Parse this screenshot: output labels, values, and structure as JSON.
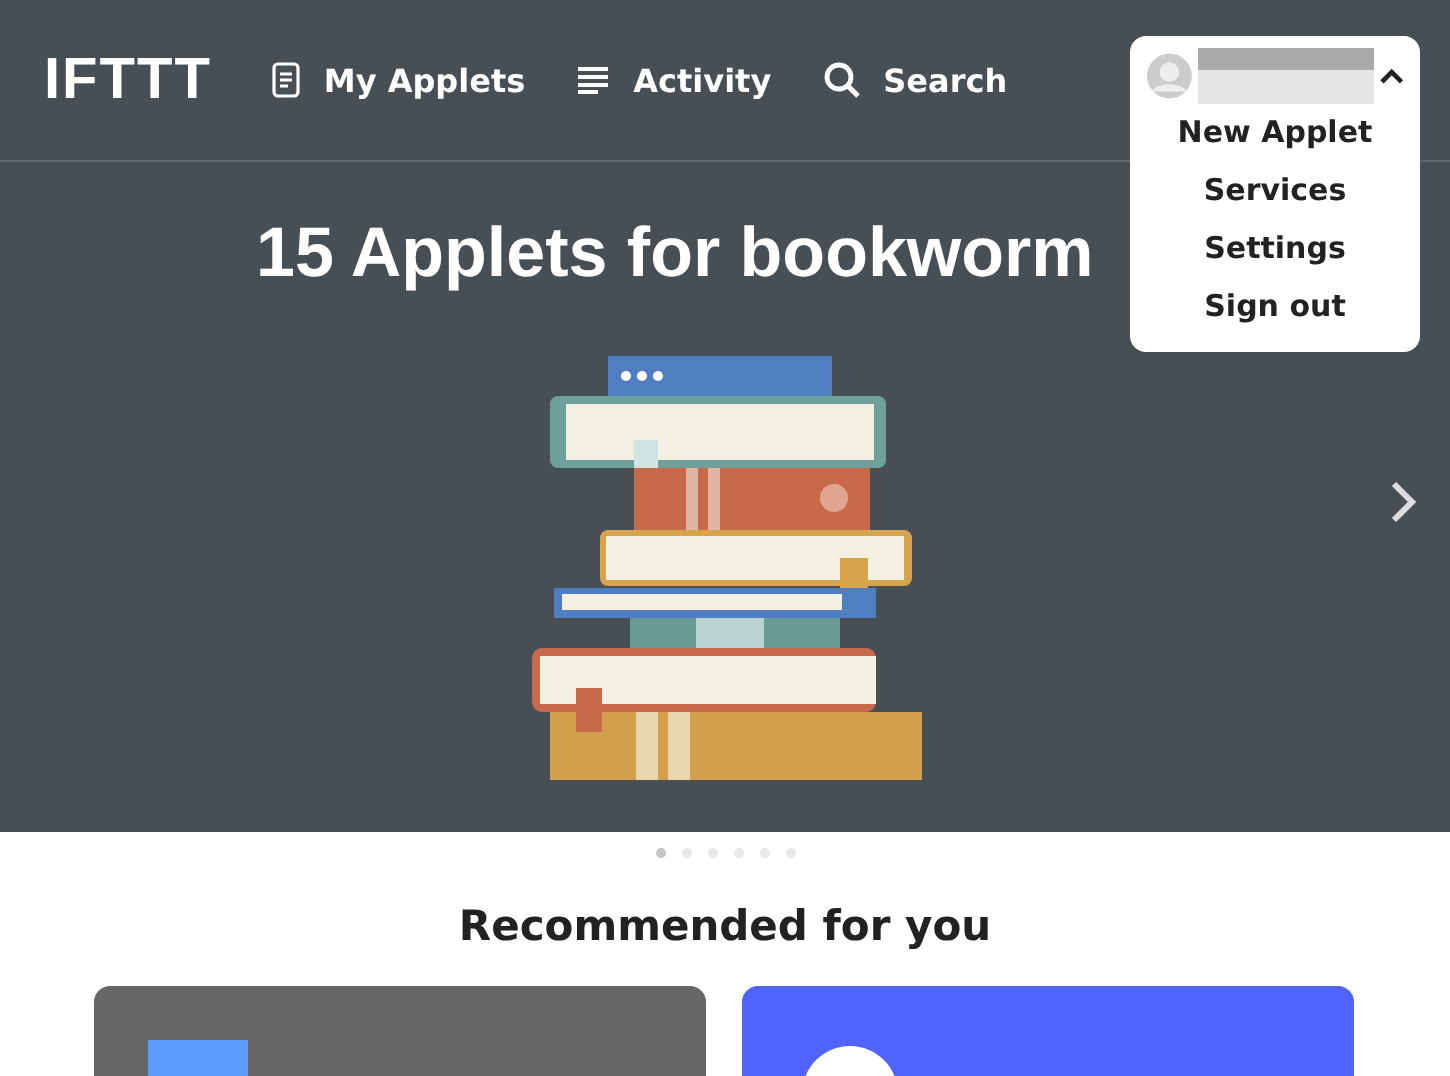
{
  "header": {
    "logo": "IFTTT",
    "nav": [
      {
        "label": "My Applets",
        "kind": "document"
      },
      {
        "label": "Activity",
        "kind": "lines"
      },
      {
        "label": "Search",
        "kind": "search"
      }
    ]
  },
  "account_menu": {
    "expanded": true,
    "items": [
      "New Applet",
      "Services",
      "Settings",
      "Sign out"
    ]
  },
  "hero": {
    "title": "15 Applets for bookworm",
    "dots": [
      {
        "selected": true
      },
      {
        "selected": false
      },
      {
        "selected": false
      },
      {
        "selected": false
      },
      {
        "selected": false
      },
      {
        "selected": false
      }
    ]
  },
  "recommended": {
    "title": "Recommended for you",
    "cards": [
      {
        "color": "#666666",
        "kind": "square"
      },
      {
        "color": "#5064fc",
        "kind": "circle"
      }
    ]
  }
}
